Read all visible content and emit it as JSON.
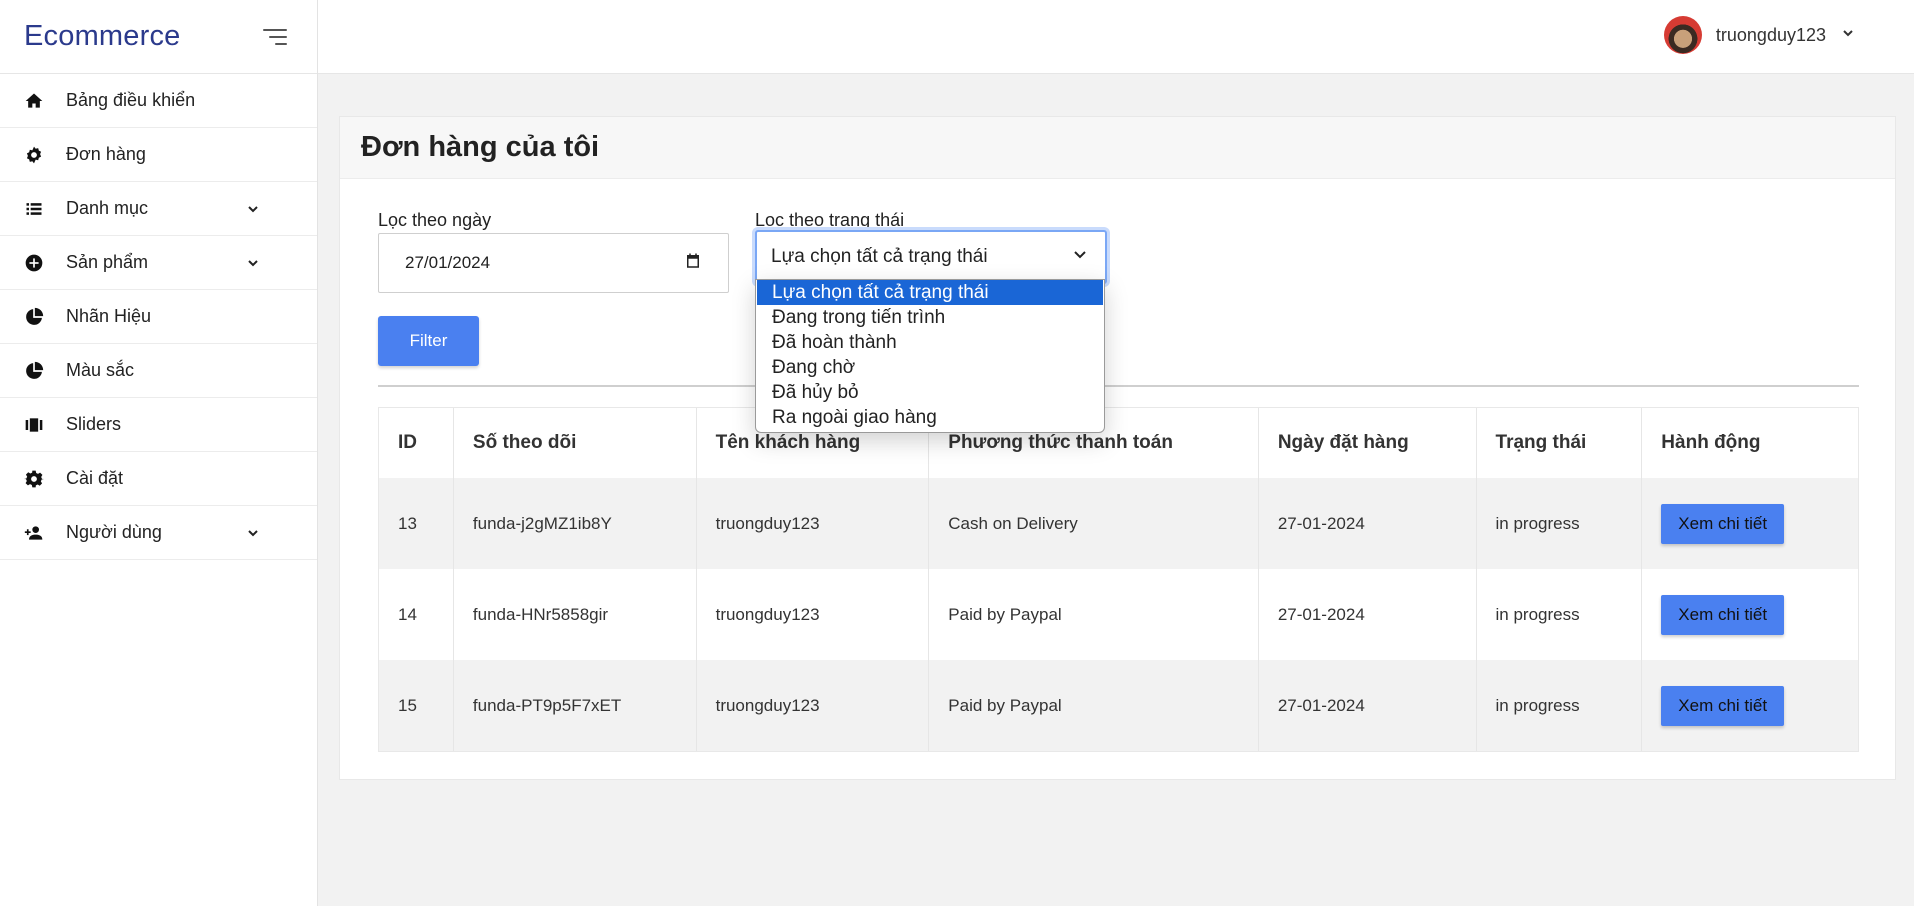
{
  "brand": "Ecommerce",
  "sidebar": {
    "items": [
      {
        "label": "Bảng điều khiển",
        "icon": "home-icon"
      },
      {
        "label": "Đơn hàng",
        "icon": "gear-badge-icon"
      },
      {
        "label": "Danh mục",
        "icon": "list-icon",
        "expandable": true
      },
      {
        "label": "Sản phẩm",
        "icon": "plus-circle-icon",
        "expandable": true
      },
      {
        "label": "Nhãn Hiệu",
        "icon": "pie-icon"
      },
      {
        "label": "Màu sắc",
        "icon": "pie-icon"
      },
      {
        "label": "Sliders",
        "icon": "slider-icon"
      },
      {
        "label": "Cài đặt",
        "icon": "gear-icon"
      },
      {
        "label": "Người dùng",
        "icon": "user-add-icon",
        "expandable": true
      }
    ]
  },
  "topbar": {
    "username": "truongduy123"
  },
  "page": {
    "title": "Đơn hàng của tôi"
  },
  "filters": {
    "date_label": "Lọc theo ngày",
    "date_value": "27/01/2024",
    "status_label": "Lọc theo trạng thái",
    "status_value": "Lựa chọn tất cả trạng thái",
    "status_options": [
      "Lựa chọn tất cả trạng thái",
      "Đang trong tiến trình",
      "Đã hoàn thành",
      "Đang chờ",
      "Đã hủy bỏ",
      "Ra ngoài giao hàng"
    ],
    "filter_button": "Filter"
  },
  "table": {
    "headers": [
      "ID",
      "Số theo dõi",
      "Tên khách hàng",
      "Phương thức thanh toán",
      "Ngày đặt hàng",
      "Trạng thái",
      "Hành động"
    ],
    "rows": [
      {
        "id": "13",
        "tracking": "funda-j2gMZ1ib8Y",
        "customer": "truongduy123",
        "payment": "Cash on Delivery",
        "date": "27-01-2024",
        "status": "in progress",
        "action": "Xem chi tiết"
      },
      {
        "id": "14",
        "tracking": "funda-HNr5858gir",
        "customer": "truongduy123",
        "payment": "Paid by Paypal",
        "date": "27-01-2024",
        "status": "in progress",
        "action": "Xem chi tiết"
      },
      {
        "id": "15",
        "tracking": "funda-PT9p5F7xET",
        "customer": "truongduy123",
        "payment": "Paid by Paypal",
        "date": "27-01-2024",
        "status": "in progress",
        "action": "Xem chi tiết"
      }
    ]
  },
  "colors": {
    "accent": "#4a80f0",
    "brand": "#2b3a8c",
    "selected_option": "#1a66d6"
  }
}
